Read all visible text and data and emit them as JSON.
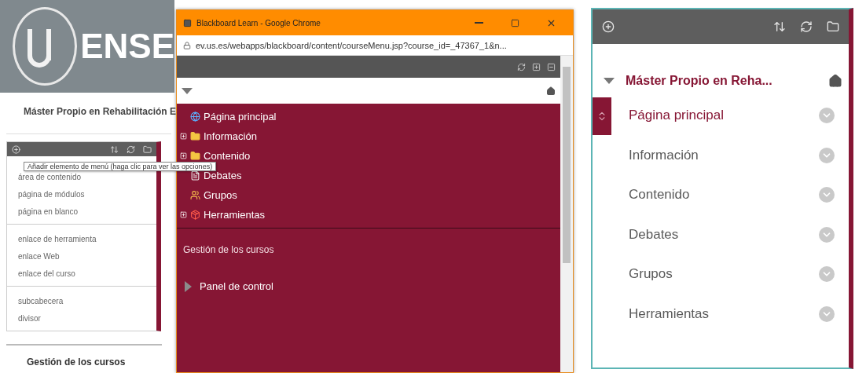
{
  "left_page": {
    "banner_text": "ENSE",
    "course_title": "Máster Propio en Rehabilitación E",
    "add_menu": {
      "groups": [
        {
          "items": [
            "área de contenido",
            "página de módulos",
            "página en blanco"
          ]
        },
        {
          "items": [
            "enlace de herramienta",
            "enlace Web",
            "enlace del curso"
          ]
        },
        {
          "items": [
            "subcabecera",
            "divisor"
          ]
        }
      ]
    },
    "footer_heading": "Gestión de los cursos"
  },
  "tooltip": "Añadir elemento de menú (haga clic para ver las opciones)",
  "popup": {
    "window_title": "Blackboard Learn - Google Chrome",
    "url": "ev.us.es/webapps/blackboard/content/courseMenu.jsp?course_id=_47367_1&n...",
    "tree": [
      {
        "label": "Página principal",
        "kind": "page",
        "expandable": false
      },
      {
        "label": "Información",
        "kind": "folder",
        "expandable": true
      },
      {
        "label": "Contenido",
        "kind": "folder",
        "expandable": true
      },
      {
        "label": "Debates",
        "kind": "discussion",
        "expandable": false
      },
      {
        "label": "Grupos",
        "kind": "groups",
        "expandable": false
      },
      {
        "label": "Herramientas",
        "kind": "tools",
        "expandable": true
      }
    ],
    "section_heading": "Gestión de los cursos",
    "panel_link": "Panel de control"
  },
  "course_menu": {
    "title": "Máster Propio en Reha...",
    "items": [
      {
        "label": "Página principal",
        "selected": true
      },
      {
        "label": "Información",
        "selected": false
      },
      {
        "label": "Contenido",
        "selected": false
      },
      {
        "label": "Debates",
        "selected": false
      },
      {
        "label": "Grupos",
        "selected": false
      },
      {
        "label": "Herramientas",
        "selected": false
      }
    ]
  }
}
